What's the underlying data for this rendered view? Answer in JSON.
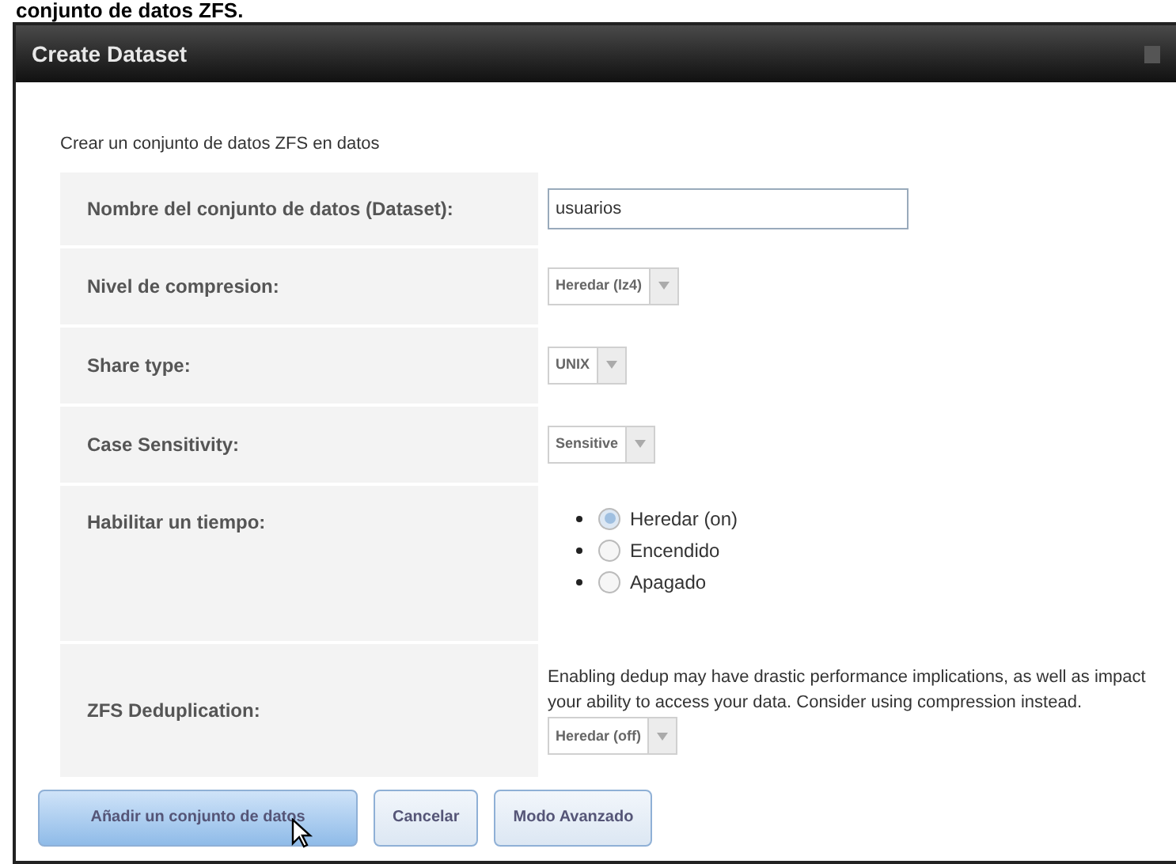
{
  "page_heading": "conjunto de datos ZFS.",
  "window": {
    "title": "Create Dataset"
  },
  "intro": "Crear un conjunto de datos ZFS en datos",
  "fields": [
    {
      "kind": "text",
      "label": "Nombre del conjunto de datos (Dataset):",
      "value": "usuarios"
    },
    {
      "kind": "select",
      "label": "Nivel de compresion:",
      "value": "Heredar (lz4)"
    },
    {
      "kind": "select",
      "label": "Share type:",
      "value": "UNIX"
    },
    {
      "kind": "select",
      "label": "Case Sensitivity:",
      "value": "Sensitive"
    },
    {
      "kind": "radio",
      "label": "Habilitar un tiempo:",
      "options": [
        {
          "label": "Heredar (on)",
          "selected": true
        },
        {
          "label": "Encendido",
          "selected": false
        },
        {
          "label": "Apagado",
          "selected": false
        }
      ]
    },
    {
      "kind": "select_note",
      "label": "ZFS Deduplication:",
      "note": "Enabling dedup may have drastic performance implications, as well as impact your ability to access your data. Consider using compression instead.",
      "value": "Heredar (off)"
    }
  ],
  "buttons": [
    {
      "label": "Añadir un conjunto de datos",
      "primary": true
    },
    {
      "label": "Cancelar",
      "primary": false
    },
    {
      "label": "Modo Avanzado",
      "primary": false
    }
  ]
}
